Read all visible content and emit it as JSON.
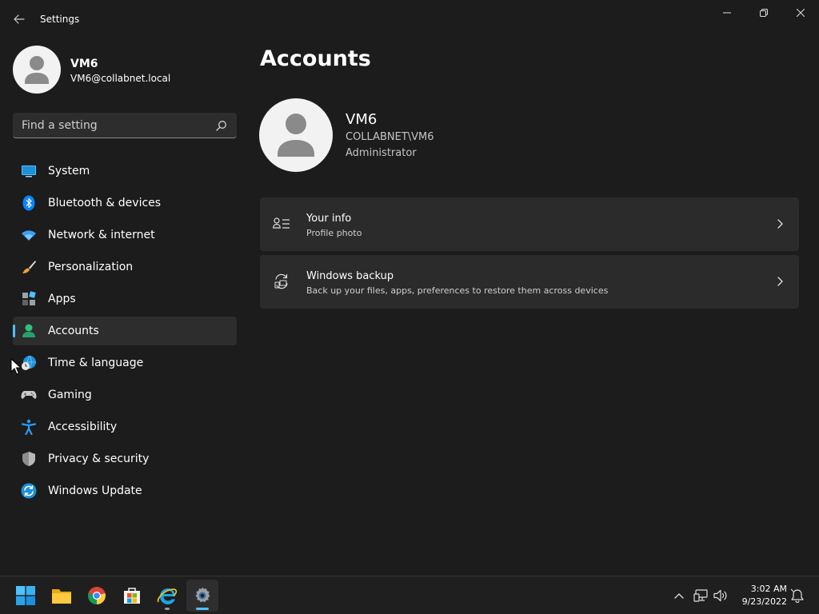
{
  "window": {
    "title": "Settings"
  },
  "profile": {
    "name": "VM6",
    "email": "VM6@collabnet.local"
  },
  "search": {
    "placeholder": "Find a setting",
    "icon": "search-icon"
  },
  "nav": {
    "items": [
      {
        "label": "System",
        "icon": "system-icon"
      },
      {
        "label": "Bluetooth & devices",
        "icon": "bluetooth-icon"
      },
      {
        "label": "Network & internet",
        "icon": "wifi-icon"
      },
      {
        "label": "Personalization",
        "icon": "brush-icon"
      },
      {
        "label": "Apps",
        "icon": "apps-icon"
      },
      {
        "label": "Accounts",
        "icon": "accounts-icon",
        "selected": true
      },
      {
        "label": "Time & language",
        "icon": "globe-clock-icon"
      },
      {
        "label": "Gaming",
        "icon": "gamepad-icon"
      },
      {
        "label": "Accessibility",
        "icon": "accessibility-icon"
      },
      {
        "label": "Privacy & security",
        "icon": "shield-icon"
      },
      {
        "label": "Windows Update",
        "icon": "update-icon"
      }
    ]
  },
  "main": {
    "title": "Accounts",
    "account": {
      "name": "VM6",
      "domain": "COLLABNET\\VM6",
      "role": "Administrator"
    },
    "cards": [
      {
        "title": "Your info",
        "subtitle": "Profile photo",
        "icon": "person-list-icon"
      },
      {
        "title": "Windows backup",
        "subtitle": "Back up your files, apps, preferences to restore them across devices",
        "icon": "backup-sync-icon"
      }
    ]
  },
  "taskbar": {
    "apps": [
      "start-icon",
      "file-explorer-icon",
      "chrome-icon",
      "store-icon",
      "internet-explorer-icon",
      "settings-icon"
    ],
    "clock": {
      "time": "3:02 AM",
      "date": "9/23/2022"
    }
  },
  "colors": {
    "background": "#1c1c1c",
    "card": "#2b2b2b",
    "accent": "#4cc2ff",
    "selected": "#2d2d2d"
  }
}
